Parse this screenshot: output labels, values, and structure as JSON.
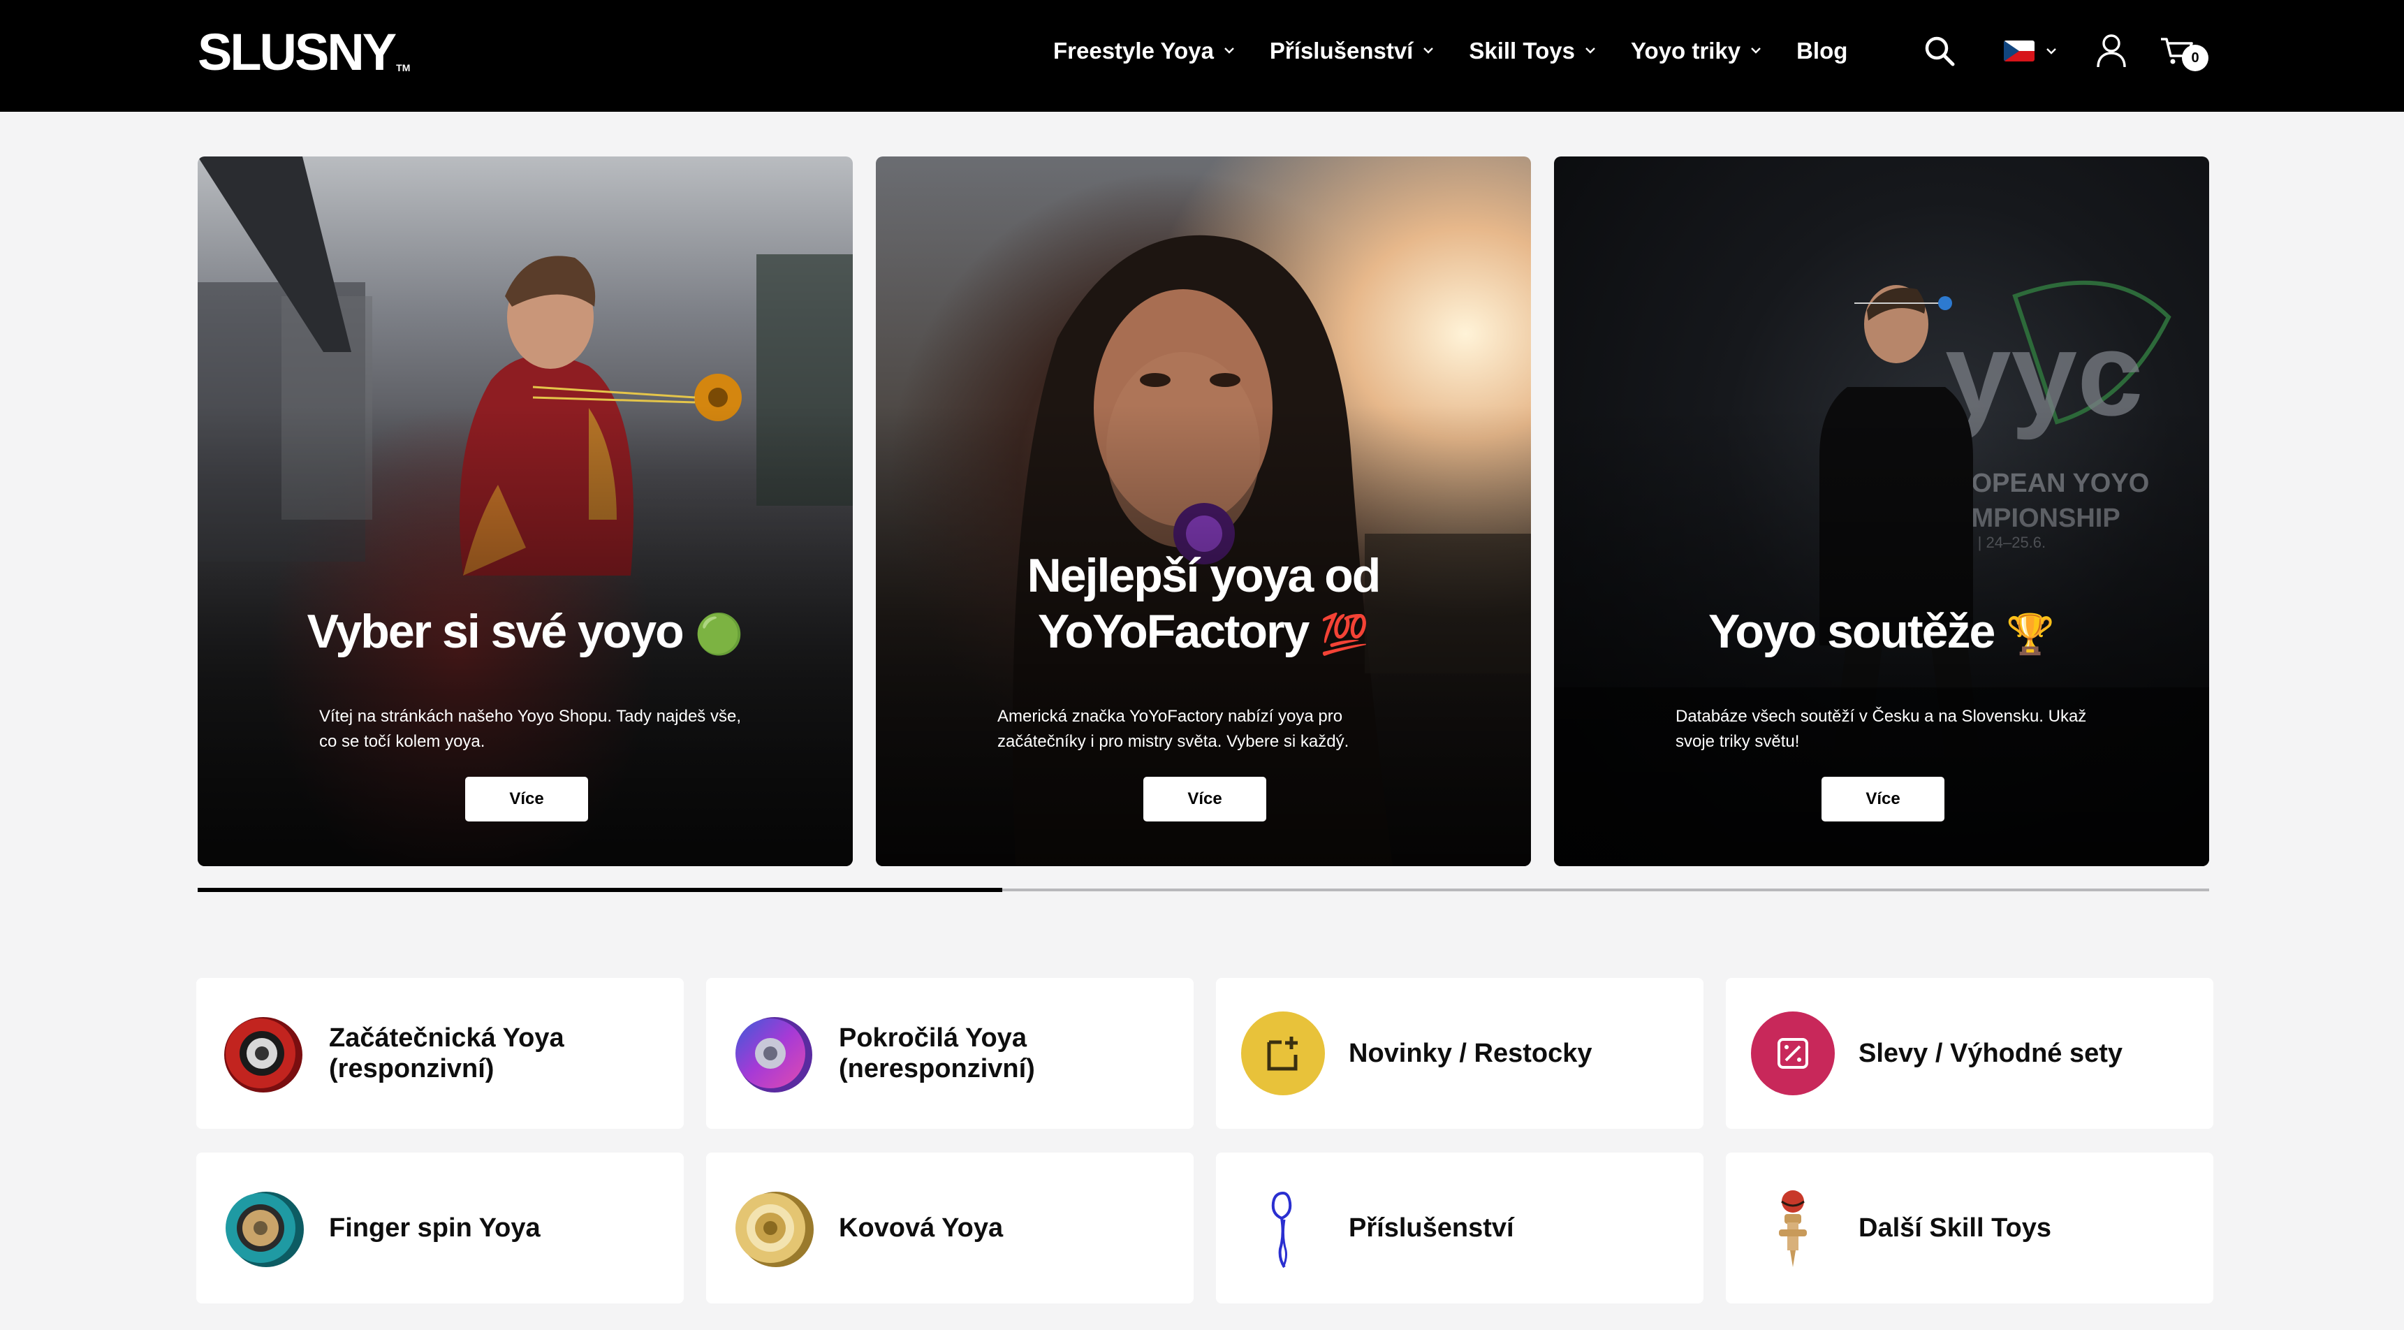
{
  "header": {
    "logo": "SLUSNY",
    "logo_tm": "TM",
    "nav": [
      {
        "label": "Freestyle Yoya",
        "has_dropdown": true
      },
      {
        "label": "Příslušenství",
        "has_dropdown": true
      },
      {
        "label": "Skill Toys",
        "has_dropdown": true
      },
      {
        "label": "Yoyo triky",
        "has_dropdown": true
      },
      {
        "label": "Blog",
        "has_dropdown": false
      }
    ],
    "cart_count": "0",
    "language_flag": "cz-flag"
  },
  "hero": [
    {
      "title": "Vyber si své yoyo",
      "emoji": "🟢",
      "description": "Vítej na stránkách našeho Yoyo Shopu. Tady najdeš vše, co se točí kolem yoya.",
      "button": "Více"
    },
    {
      "title_line1": "Nejlepší yoya od",
      "title_line2": "YoYoFactory",
      "emoji": "💯",
      "description": "Americká značka YoYoFactory nabízí yoya pro začátečníky i pro mistry světa. Vybere si každý.",
      "button": "Více"
    },
    {
      "title": "Yoyo soutěže",
      "emoji": "🏆",
      "description": "Databáze všech soutěží v Česku a na Slovensku. Ukaž svoje triky světu!",
      "button": "Více"
    }
  ],
  "carousel_progress": 0.4,
  "categories": [
    {
      "label": "Začátečnická Yoya\n(responzivní)",
      "icon": "red-yoyo-icon"
    },
    {
      "label": "Pokročilá Yoya\n(neresponzivní)",
      "icon": "purple-yoyo-icon"
    },
    {
      "label": "Novinky / Restocky",
      "icon": "new-item-icon"
    },
    {
      "label": "Slevy / Výhodné sety",
      "icon": "discount-icon"
    },
    {
      "label": "Finger spin Yoya",
      "icon": "teal-yoyo-icon"
    },
    {
      "label": "Kovová Yoya",
      "icon": "gold-yoyo-icon"
    },
    {
      "label": "Příslušenství",
      "icon": "string-icon"
    },
    {
      "label": "Další Skill Toys",
      "icon": "kendama-icon"
    }
  ],
  "colors": {
    "header_bg": "#000000",
    "page_bg": "#f4f4f5",
    "novinky_accent": "#e8c23a",
    "slevy_accent": "#c8285a"
  }
}
